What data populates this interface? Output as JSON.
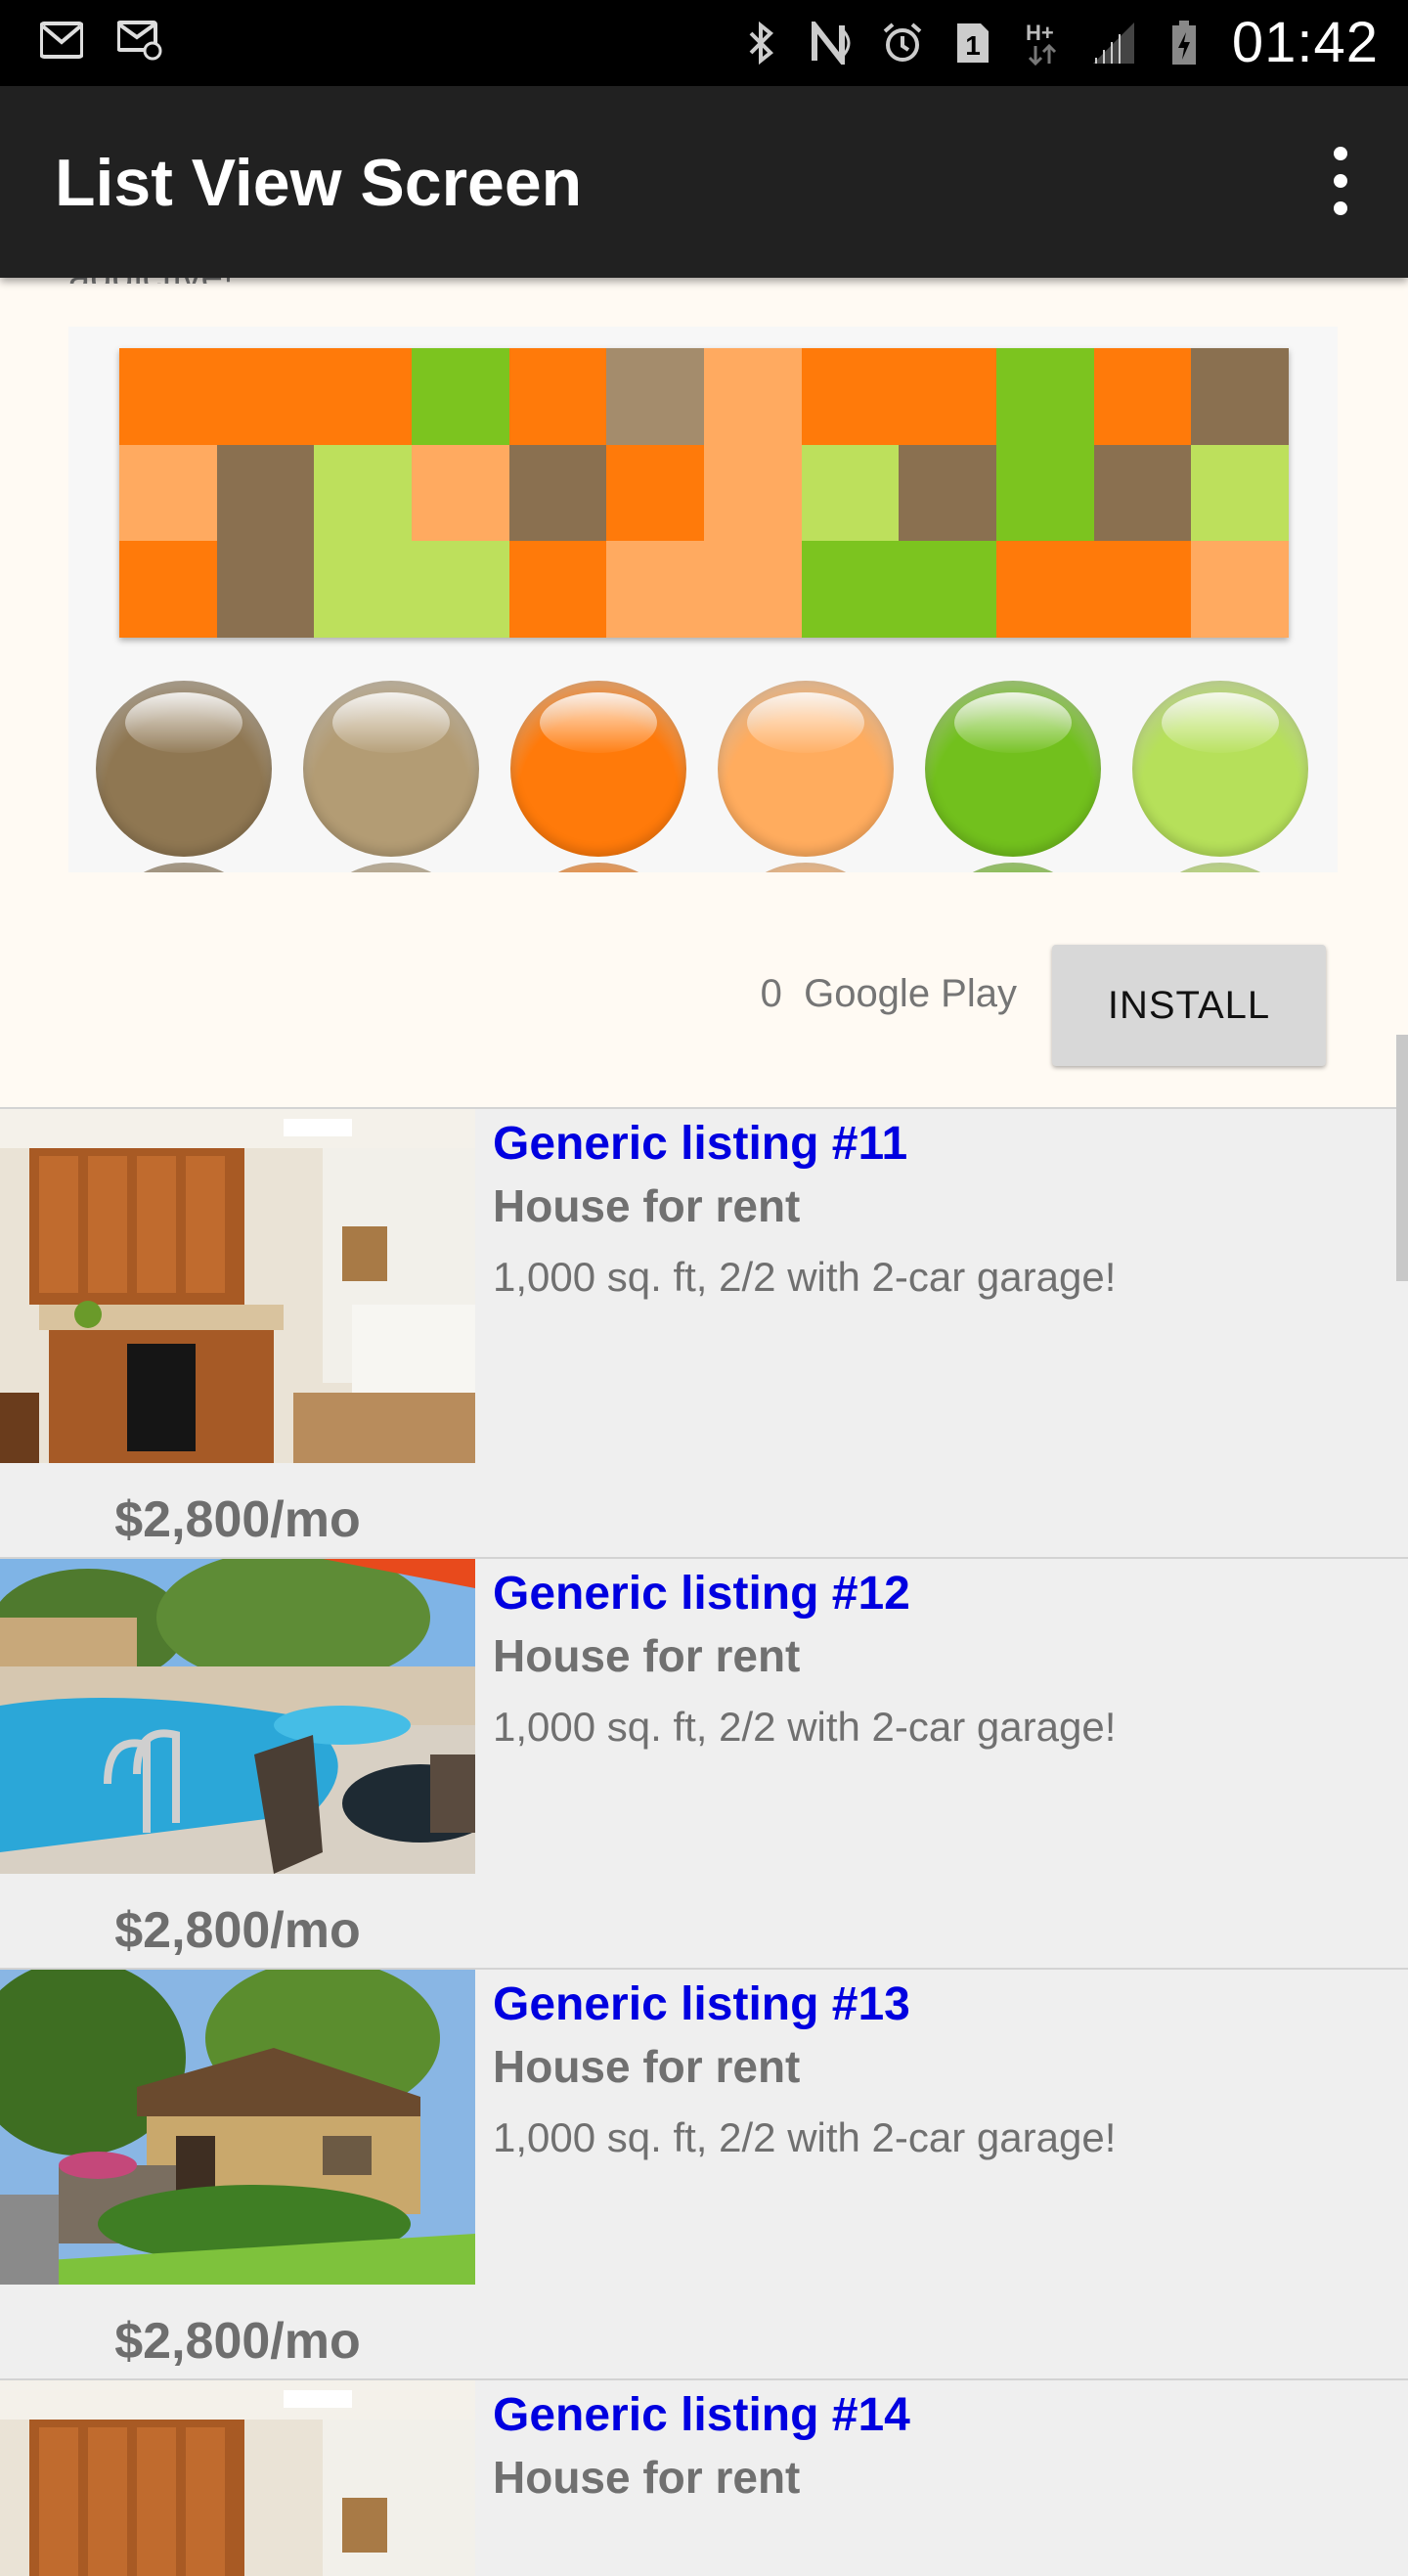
{
  "status_bar": {
    "time": "01:42",
    "left_icons": [
      "gmail-icon",
      "email-icon"
    ],
    "right_icons": [
      "bluetooth-icon",
      "nfc-icon",
      "alarm-icon",
      "sim1-icon",
      "hplus-data-icon",
      "signal-icon",
      "battery-charging-icon"
    ]
  },
  "app_bar": {
    "title": "List View Screen",
    "menu_icon": "overflow-menu-icon"
  },
  "ad": {
    "clipped_text": "addictive!",
    "rating": "0",
    "store": "Google Play",
    "install_label": "INSTALL",
    "mosaic_colors": [
      "#ff7a0a",
      "#ff7a0a",
      "#ff7a0a",
      "#7cc41f",
      "#ff7a0a",
      "#a48c6c",
      "#ffaa60",
      "#ff7a0a",
      "#ff7a0a",
      "#7cc41f",
      "#ff7a0a",
      "#8a7050",
      "#ffaa60",
      "#8a7050",
      "#bde05c",
      "#ffaa60",
      "#8a7050",
      "#ff7a0a",
      "#ffaa60",
      "#bde05c",
      "#8a7050",
      "#7cc41f",
      "#8a7050",
      "#bde05c",
      "#ff7a0a",
      "#8a7050",
      "#bde05c",
      "#bde05c",
      "#ff7a0a",
      "#ffaa60",
      "#ffaa60",
      "#7cc41f",
      "#7cc41f",
      "#ff7a0a",
      "#ff7a0a",
      "#ffaa60"
    ],
    "ball_colors": [
      "#8f7752",
      "#b39c74",
      "#ff7a0a",
      "#ffac5e",
      "#72c01d",
      "#b6e05a"
    ]
  },
  "listings": [
    {
      "title": "Generic listing #11",
      "subtitle": "House for rent",
      "description": "1,000 sq. ft, 2/2 with 2-car garage!",
      "price": "$2,800/mo",
      "image": "kitchen"
    },
    {
      "title": "Generic listing #12",
      "subtitle": "House for rent",
      "description": "1,000 sq. ft, 2/2 with 2-car garage!",
      "price": "$2,800/mo",
      "image": "pool"
    },
    {
      "title": "Generic listing #13",
      "subtitle": "House for rent",
      "description": "1,000 sq. ft, 2/2 with 2-car garage!",
      "price": "$2,800/mo",
      "image": "house"
    },
    {
      "title": "Generic listing #14",
      "subtitle": "House for rent",
      "description": "",
      "price": "",
      "image": "kitchen"
    }
  ]
}
